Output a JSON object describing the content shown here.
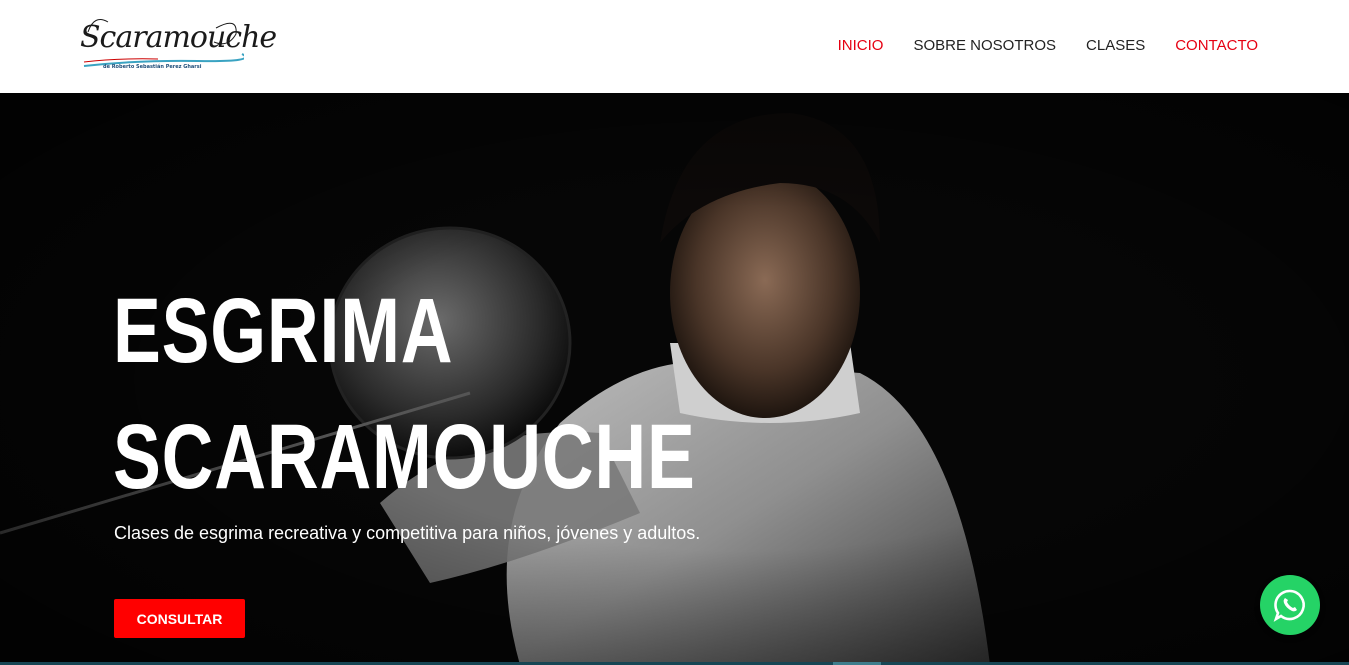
{
  "brand": {
    "logo_text": "Scaramouche",
    "logo_subtext": "de Roberto Sebastián Perez Gharsi",
    "colors": {
      "accent_red": "#e60012",
      "cta_red": "#ff0000",
      "whatsapp_green": "#25d366"
    }
  },
  "nav": {
    "items": [
      {
        "label": "INICIO",
        "state": "active"
      },
      {
        "label": "SOBRE NOSOTROS"
      },
      {
        "label": "CLASES"
      },
      {
        "label": "CONTACTO",
        "state": "highlight"
      }
    ]
  },
  "hero": {
    "title_line1": "ESGRIMA",
    "title_line2": "SCARAMOUCHE",
    "subtitle": "Clases de esgrima recreativa y competitiva para niños, jóvenes y adultos.",
    "cta_label": "CONSULTAR"
  },
  "floating": {
    "icon": "whatsapp-icon"
  }
}
